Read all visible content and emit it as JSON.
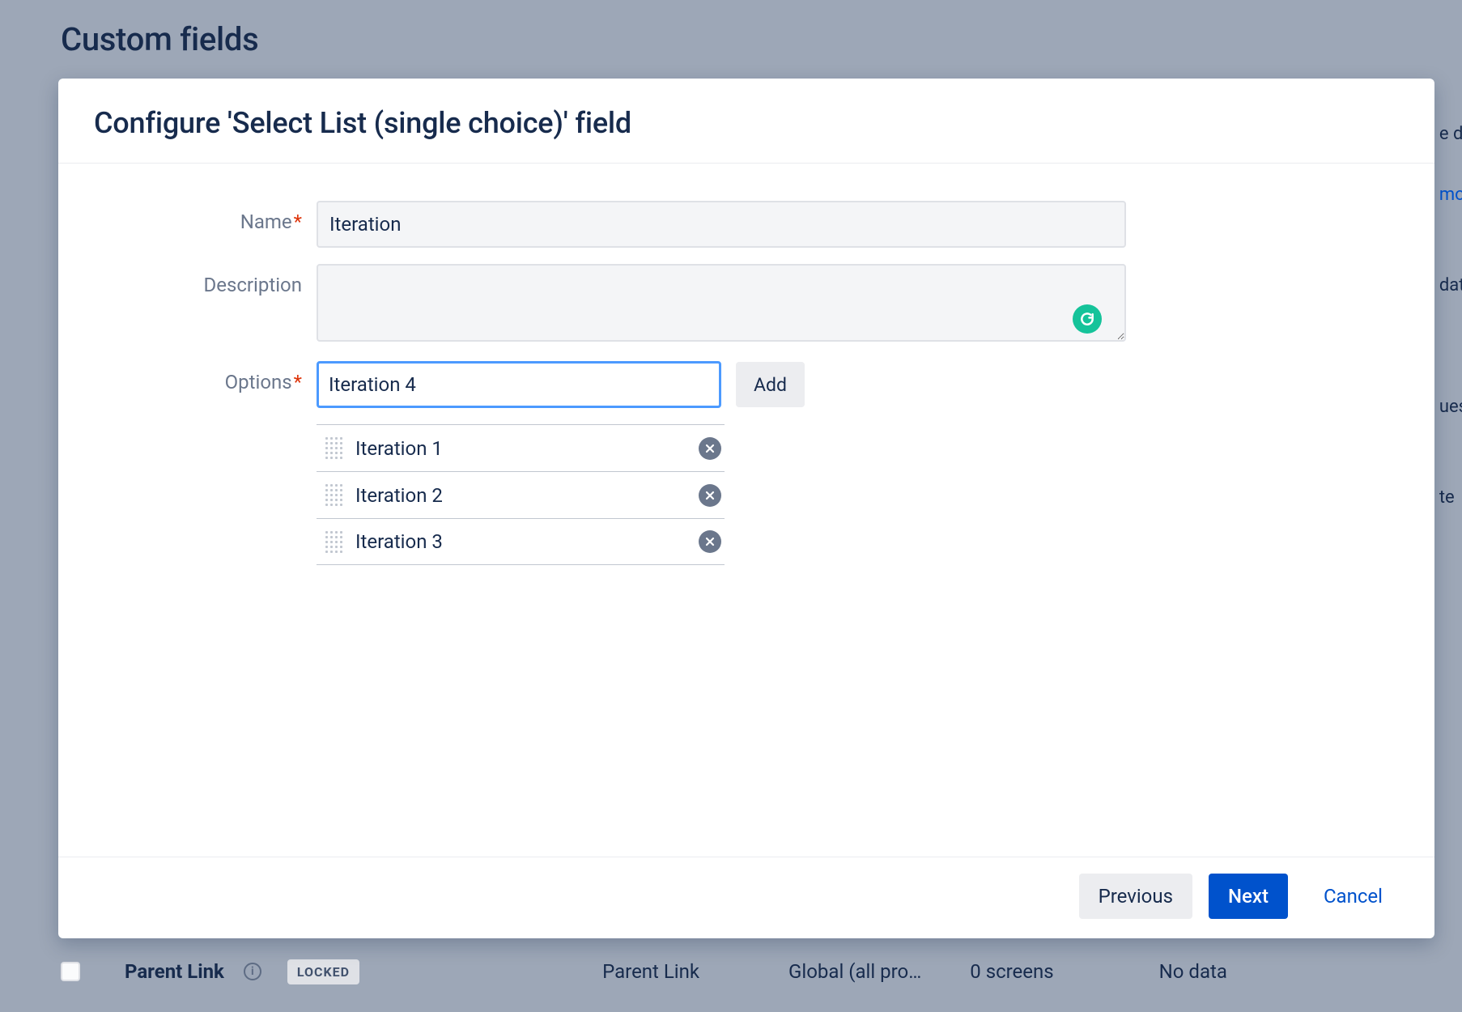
{
  "background": {
    "page_title": "Custom fields",
    "right_snippets": [
      "e diff",
      "mor",
      "date",
      "ues:",
      "te"
    ],
    "row": {
      "name": "Parent Link",
      "locked_badge": "LOCKED",
      "col_type": "Parent Link",
      "col_context": "Global (all pro…",
      "col_screens": "0 screens",
      "col_data": "No data"
    }
  },
  "modal": {
    "title": "Configure 'Select List (single choice)' field",
    "labels": {
      "name": "Name",
      "description": "Description",
      "options": "Options"
    },
    "name_value": "Iteration",
    "description_value": "",
    "option_input_value": "Iteration 4",
    "add_button": "Add",
    "options": [
      {
        "label": "Iteration 1"
      },
      {
        "label": "Iteration 2"
      },
      {
        "label": "Iteration 3"
      }
    ],
    "footer": {
      "previous": "Previous",
      "next": "Next",
      "cancel": "Cancel"
    }
  }
}
